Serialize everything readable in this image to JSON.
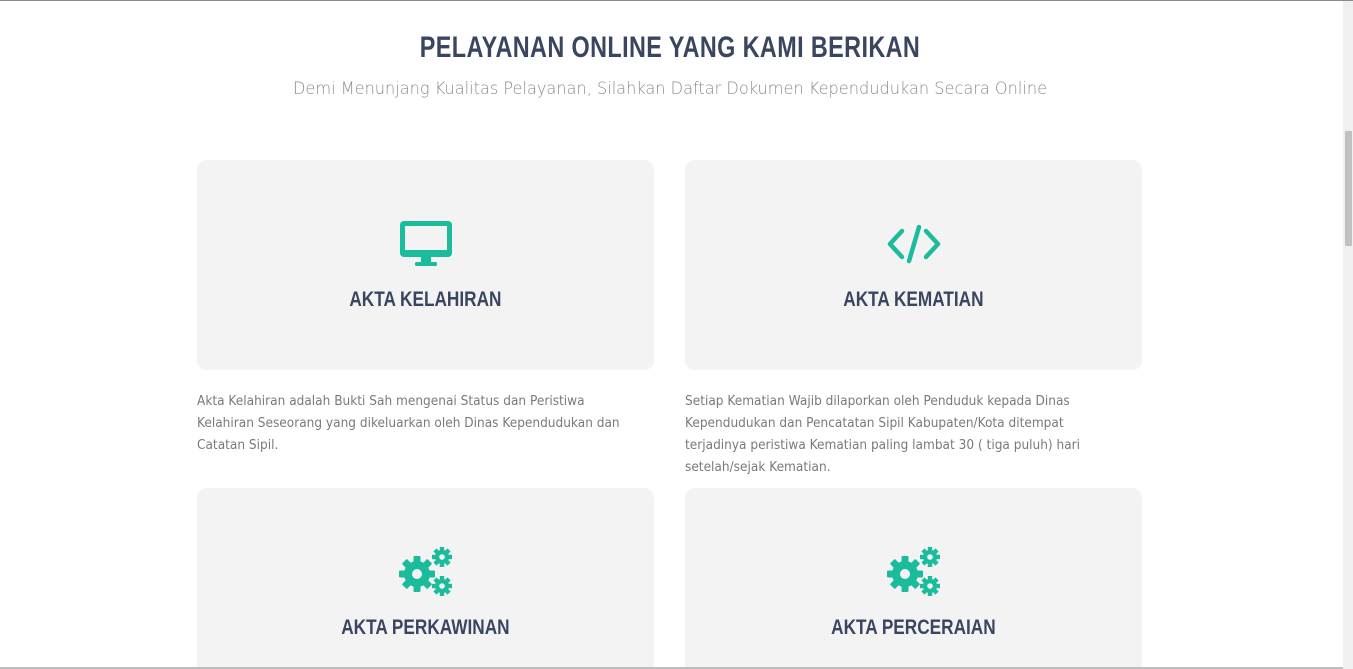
{
  "header": {
    "title": "PELAYANAN ONLINE YANG KAMI BERIKAN",
    "subtitle": "Demi Menunjang Kualitas Pelayanan, Silahkan Daftar Dokumen Kependudukan Secara Online"
  },
  "services": [
    {
      "icon": "monitor-icon",
      "title": "AKTA KELAHIRAN",
      "description": "Akta Kelahiran adalah Bukti Sah mengenai Status dan Peristiwa Kelahiran Seseorang yang dikeluarkan oleh Dinas Kependudukan dan Catatan Sipil."
    },
    {
      "icon": "code-icon",
      "title": "AKTA KEMATIAN",
      "description": "Setiap Kematian Wajib dilaporkan oleh Penduduk kepada Dinas Kependudukan dan Pencatatan Sipil Kabupaten/Kota ditempat terjadinya peristiwa Kematian paling lambat 30 ( tiga puluh) hari setelah/sejak Kematian."
    },
    {
      "icon": "gears-icon",
      "title": "AKTA PERKAWINAN"
    },
    {
      "icon": "gears-icon",
      "title": "AKTA PERCERAIAN"
    }
  ],
  "colors": {
    "accent": "#1abc9c",
    "heading": "#3a4660",
    "text": "#7a7a7a",
    "card_bg": "#f3f3f3"
  }
}
